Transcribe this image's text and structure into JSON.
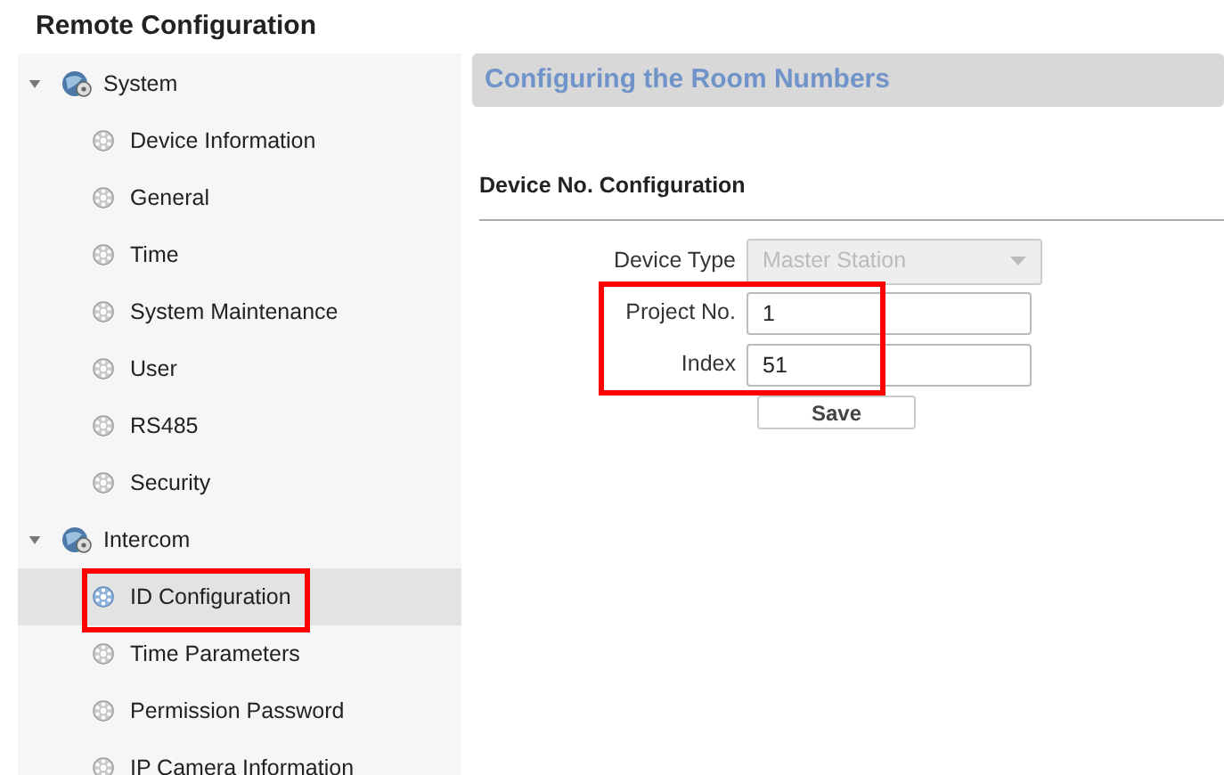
{
  "title": "Remote Configuration",
  "tree": [
    {
      "label": "System",
      "expanded": true,
      "children": [
        {
          "label": "Device Information",
          "selected": false,
          "annotated": false
        },
        {
          "label": "General",
          "selected": false,
          "annotated": false
        },
        {
          "label": "Time",
          "selected": false,
          "annotated": false
        },
        {
          "label": "System Maintenance",
          "selected": false,
          "annotated": false
        },
        {
          "label": "User",
          "selected": false,
          "annotated": false
        },
        {
          "label": "RS485",
          "selected": false,
          "annotated": false
        },
        {
          "label": "Security",
          "selected": false,
          "annotated": false
        }
      ]
    },
    {
      "label": "Intercom",
      "expanded": true,
      "children": [
        {
          "label": "ID Configuration",
          "selected": true,
          "annotated": true
        },
        {
          "label": "Time Parameters",
          "selected": false,
          "annotated": false
        },
        {
          "label": "Permission Password",
          "selected": false,
          "annotated": false
        },
        {
          "label": "IP Camera Information",
          "selected": false,
          "annotated": false
        }
      ]
    }
  ],
  "panel_title": "Configuring the Room Numbers",
  "section_title": "Device No. Configuration",
  "form": {
    "fields": [
      {
        "kind": "select",
        "label": "Device Type",
        "value": "Master Station",
        "disabled": true
      },
      {
        "kind": "text",
        "label": "Project No.",
        "value": "1",
        "disabled": false
      },
      {
        "kind": "text",
        "label": "Index",
        "value": "51",
        "disabled": false
      }
    ],
    "annotated_fields": true,
    "button": "Save"
  }
}
